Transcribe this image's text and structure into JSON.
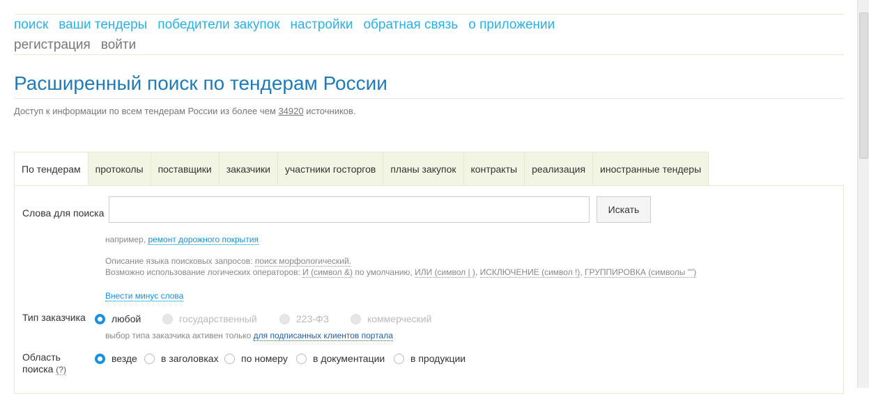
{
  "nav": {
    "row1": [
      "поиск",
      "ваши тендеры",
      "победители закупок",
      "настройки",
      "обратная связь",
      "о приложении"
    ],
    "row2": [
      "регистрация",
      "войти"
    ]
  },
  "title": "Расширенный поиск по тендерам России",
  "subtitle": {
    "before": "Доступ к информации по всем тендерам России из более чем",
    "count": "34920",
    "after": "источников."
  },
  "tabs": [
    "По тендерам",
    "протоколы",
    "поставщики",
    "заказчики",
    "участники госторгов",
    "планы закупок",
    "контракты",
    "реализация",
    "иностранные тендеры"
  ],
  "search": {
    "label": "Слова для поиска",
    "value": "",
    "button": "Искать",
    "example_prefix": "например,",
    "example_link": "ремонт дорожного покрытия",
    "desc_prefix": "Описание языка поисковых запросов:",
    "desc_link": "поиск морфологический.",
    "ops_prefix": "Возможно использование логических операторов:",
    "op_and": "И (символ &)",
    "op_and_suffix": "по умолчанию,",
    "op_or": "ИЛИ (символ | )",
    "op_not": "ИСКЛЮЧЕНИЕ (символ !)",
    "op_group": "ГРУППИРОВКА (символы \"\")",
    "minus_link": "Внести минус слова"
  },
  "customer_type": {
    "label": "Тип заказчика",
    "options": [
      "любой",
      "государственный",
      "223-ФЗ",
      "коммерческий"
    ],
    "selected": "любой",
    "note": "выбор типа заказчика активен только",
    "note_link": "для подписанных клиентов портала"
  },
  "area": {
    "label1": "Область",
    "label2": "поиска",
    "help": "(?)",
    "options": [
      "везде",
      "в заголовках",
      "по номеру",
      "в документации",
      "в продукции"
    ],
    "selected": "везде"
  }
}
